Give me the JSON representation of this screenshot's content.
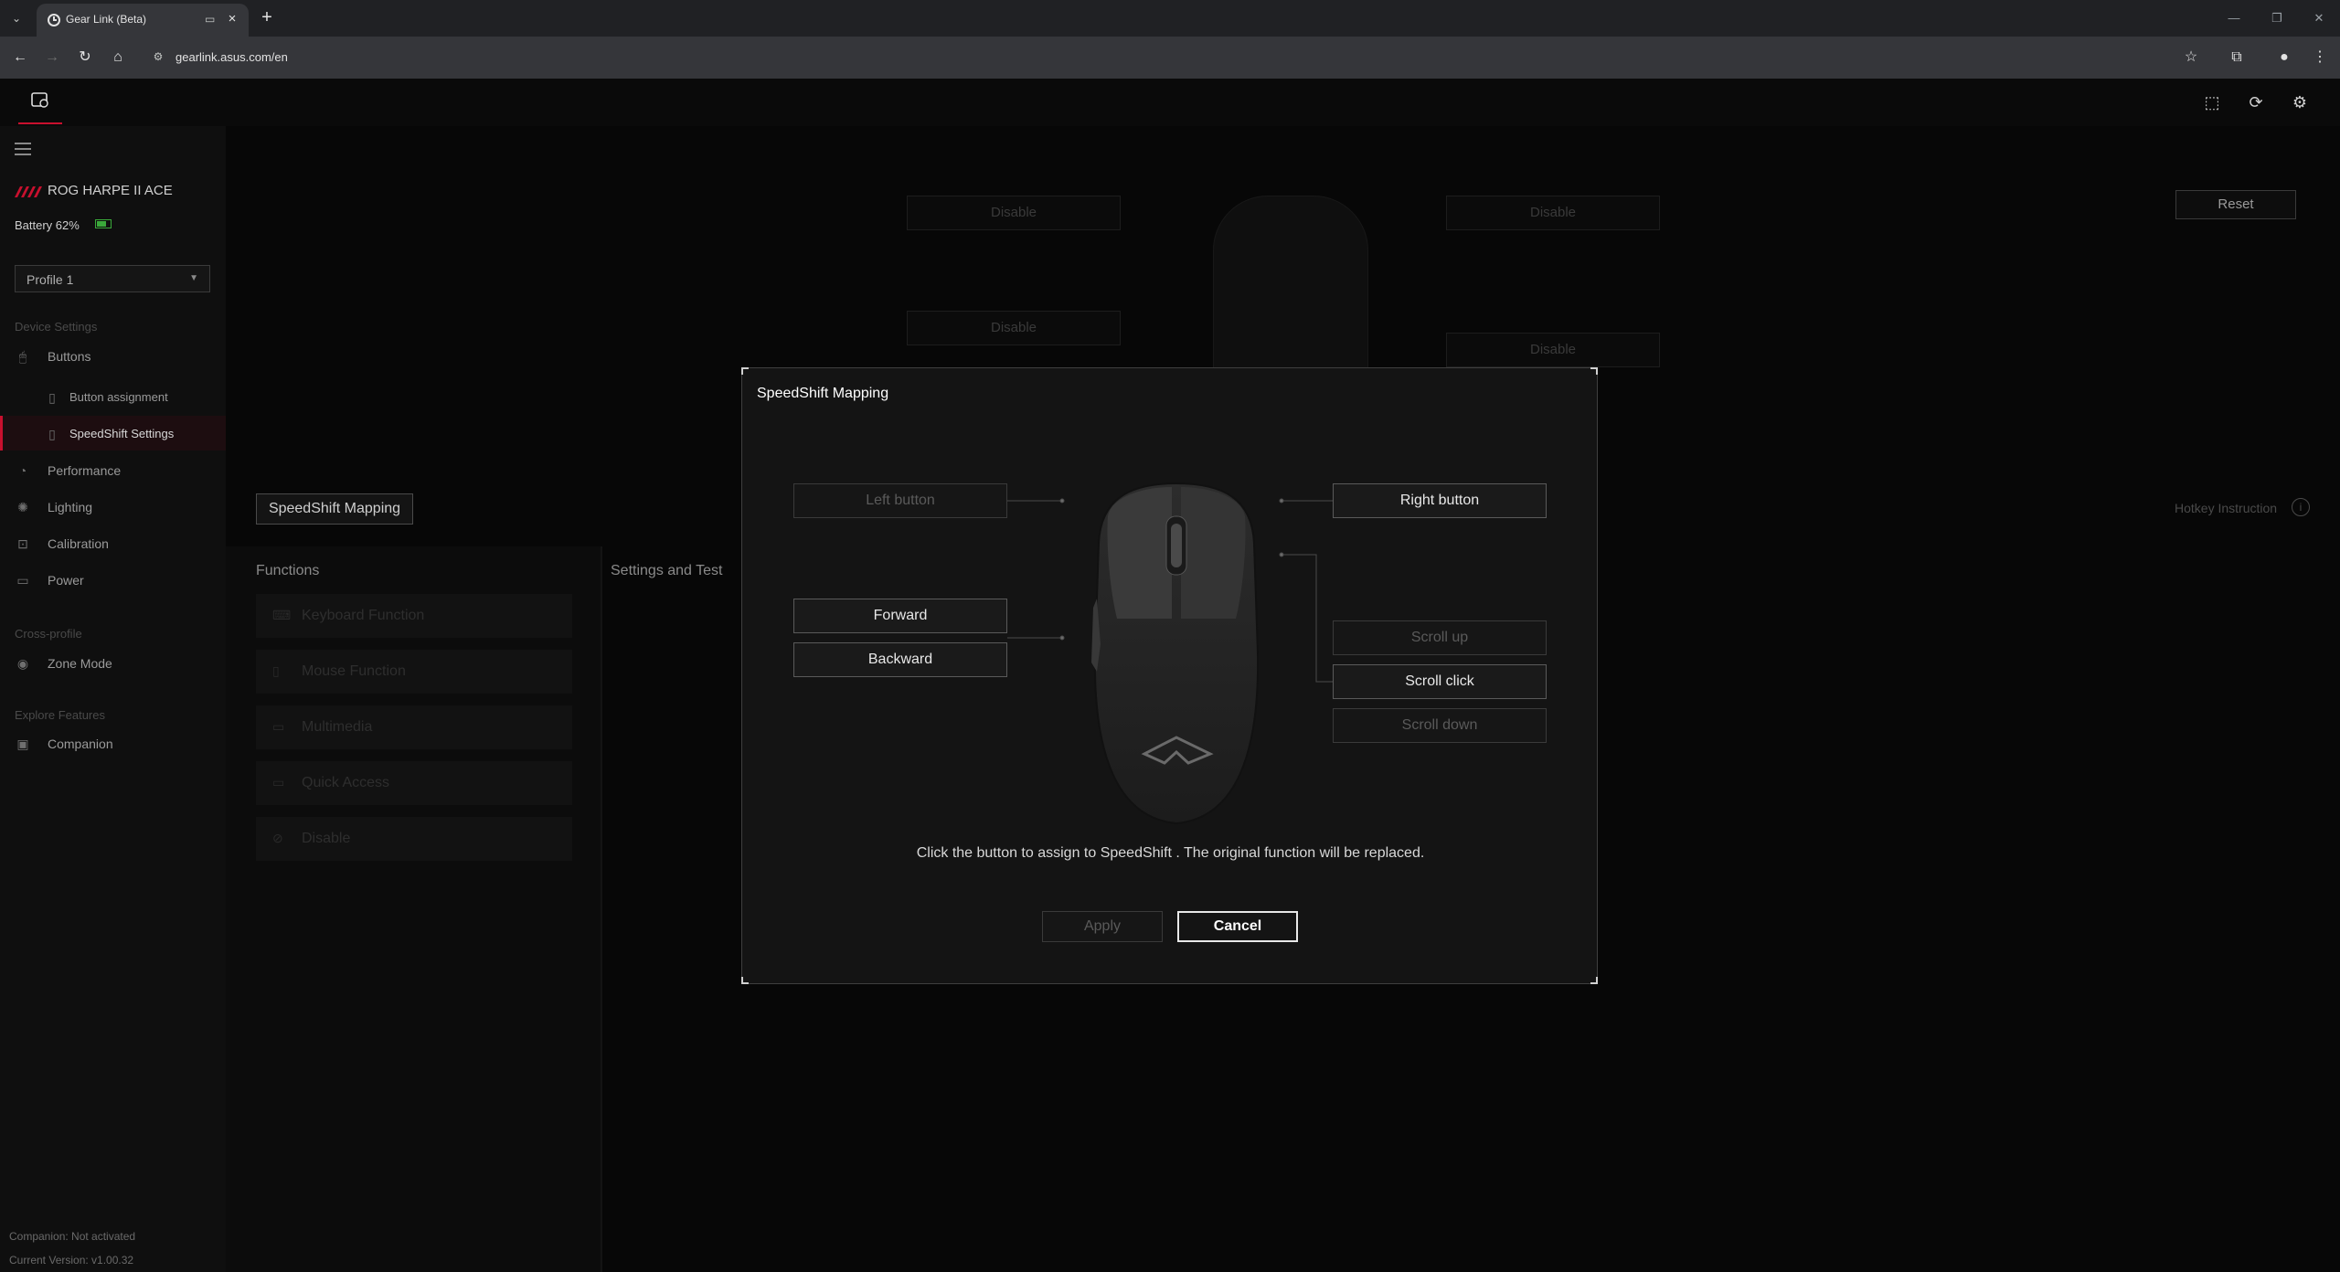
{
  "browser": {
    "tab_title": "Gear Link (Beta)",
    "url": "gearlink.asus.com/en"
  },
  "app": {
    "reset_label": "Reset",
    "sidebar": {
      "device_name": "ROG HARPE II ACE",
      "battery": "Battery 62%",
      "profile": "Profile 1",
      "section_device_settings": "Device Settings",
      "buttons": "Buttons",
      "button_assignment": "Button assignment",
      "speedshift_settings": "SpeedShift Settings",
      "performance": "Performance",
      "lighting": "Lighting",
      "calibration": "Calibration",
      "power": "Power",
      "section_cross_profile": "Cross-profile",
      "zone_mode": "Zone Mode",
      "section_explore": "Explore Features",
      "companion": "Companion",
      "companion_status": "Companion: Not activated",
      "current_version": "Current Version: v1.00.32"
    },
    "background_slots": {
      "top_left": "Disable",
      "top_right": "Disable",
      "mid_left": "Disable",
      "mid_right": "Disable"
    },
    "speedshift_mapping_button": "SpeedShift Mapping",
    "hotkey_instruction": "Hotkey Instruction",
    "functions_title": "Functions",
    "settings_title": "Settings and Test",
    "functions": [
      {
        "label": "Keyboard Function",
        "icon": "keyboard-icon"
      },
      {
        "label": "Mouse Function",
        "icon": "mouse-icon"
      },
      {
        "label": "Multimedia",
        "icon": "multimedia-icon"
      },
      {
        "label": "Quick Access",
        "icon": "quick-access-icon"
      },
      {
        "label": "Disable",
        "icon": "disable-icon"
      }
    ]
  },
  "dialog": {
    "title": "SpeedShift Mapping",
    "left_button": "Left button",
    "right_button": "Right button",
    "forward": "Forward",
    "backward": "Backward",
    "scroll_up": "Scroll up",
    "scroll_click": "Scroll click",
    "scroll_down": "Scroll down",
    "message": "Click the button to assign to SpeedShift . The original function will be replaced.",
    "apply": "Apply",
    "cancel": "Cancel"
  },
  "colors": {
    "accent": "#c8102e",
    "battery": "#3aa83a"
  }
}
